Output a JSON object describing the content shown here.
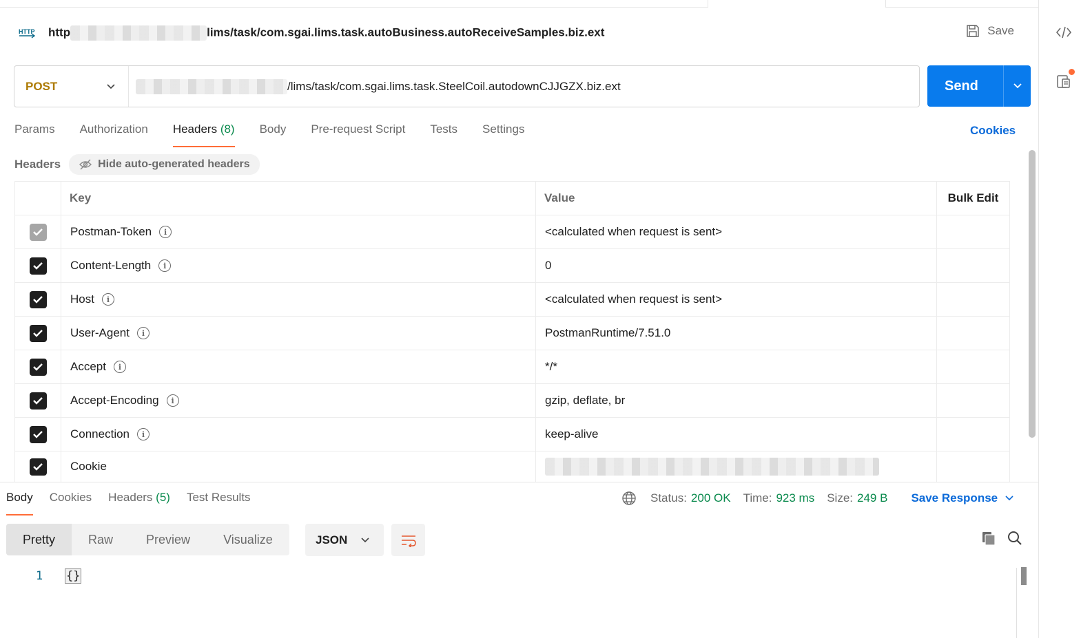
{
  "title": {
    "prefix": "http",
    "suffix": "lims/task/com.sgai.lims.task.autoBusiness.autoReceiveSamples.biz.ext",
    "save_label": "Save"
  },
  "request": {
    "method": "POST",
    "url_suffix": "/lims/task/com.sgai.lims.task.SteelCoil.autodownCJJGZX.biz.ext",
    "send_label": "Send"
  },
  "req_tabs": [
    {
      "label": "Params"
    },
    {
      "label": "Authorization"
    },
    {
      "label": "Headers",
      "count": "(8)"
    },
    {
      "label": "Body"
    },
    {
      "label": "Pre-request Script"
    },
    {
      "label": "Tests"
    },
    {
      "label": "Settings"
    }
  ],
  "cookies_link": "Cookies",
  "headers_section": {
    "title": "Headers",
    "hide_label": "Hide auto-generated headers",
    "columns": {
      "key": "Key",
      "value": "Value",
      "bulk_edit": "Bulk Edit"
    },
    "rows": [
      {
        "key": "Postman-Token",
        "value": "<calculated when request is sent>",
        "checked": true,
        "disabled": true
      },
      {
        "key": "Content-Length",
        "value": "0",
        "checked": true
      },
      {
        "key": "Host",
        "value": "<calculated when request is sent>",
        "checked": true
      },
      {
        "key": "User-Agent",
        "value": "PostmanRuntime/7.51.0",
        "checked": true
      },
      {
        "key": "Accept",
        "value": "*/*",
        "checked": true
      },
      {
        "key": "Accept-Encoding",
        "value": "gzip, deflate, br",
        "checked": true
      },
      {
        "key": "Connection",
        "value": "keep-alive",
        "checked": true
      },
      {
        "key": "Cookie",
        "value": "",
        "checked": true
      }
    ]
  },
  "response": {
    "tabs": [
      {
        "label": "Body"
      },
      {
        "label": "Cookies"
      },
      {
        "label": "Headers",
        "count": "(5)"
      },
      {
        "label": "Test Results"
      }
    ],
    "status_label": "Status:",
    "status_value": "200 OK",
    "time_label": "Time:",
    "time_value": "923 ms",
    "size_label": "Size:",
    "size_value": "249 B",
    "save_response": "Save Response",
    "formats": [
      "Pretty",
      "Raw",
      "Preview",
      "Visualize"
    ],
    "language": "JSON",
    "line_number": "1",
    "body": "{}"
  },
  "colors": {
    "accent_orange": "#ff6c37",
    "send_blue": "#097bed",
    "link_blue": "#0b6ad9",
    "method_gold": "#ad7a03",
    "status_green": "#0a8a4d"
  }
}
